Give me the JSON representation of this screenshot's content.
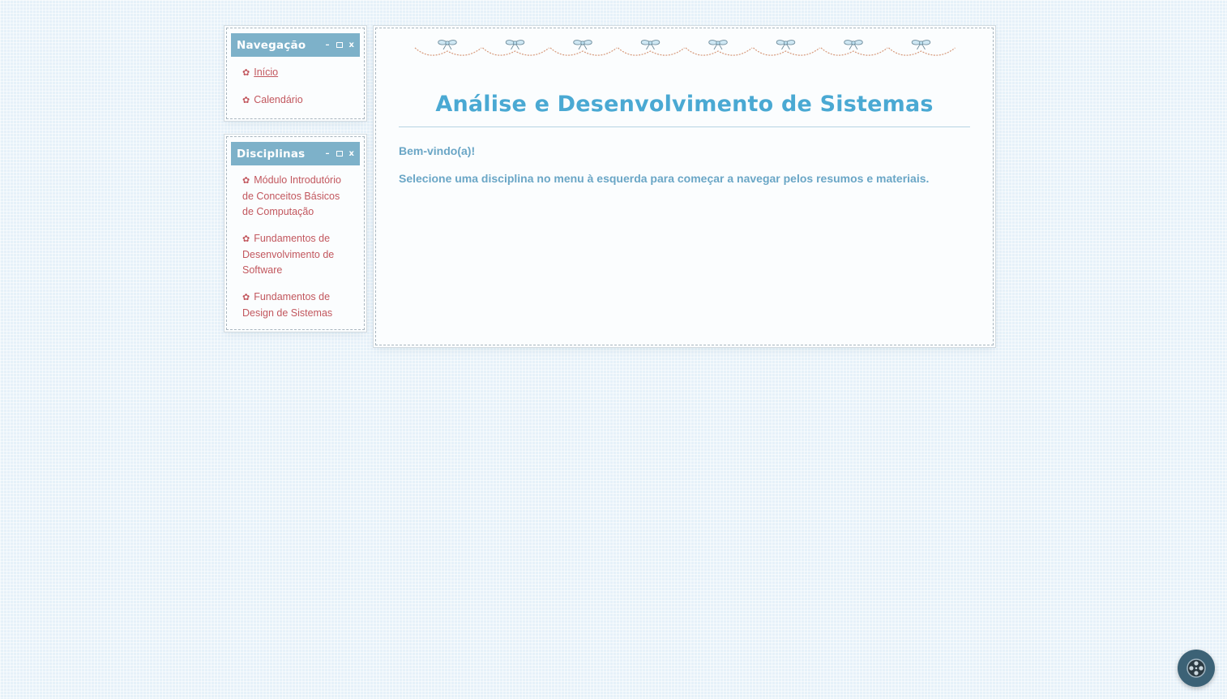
{
  "sidebar": {
    "navigation": {
      "title": "Navegação",
      "controls": {
        "minimize": "–",
        "maximize_icon": "maximize-icon",
        "close": "x"
      },
      "items": [
        {
          "label": "Início",
          "icon": "flower-icon",
          "active": true
        },
        {
          "label": "Calendário",
          "icon": "flower-icon",
          "active": false
        }
      ]
    },
    "disciplines": {
      "title": "Disciplinas",
      "controls": {
        "minimize": "–",
        "maximize_icon": "maximize-icon",
        "close": "x"
      },
      "items": [
        {
          "label": "Módulo Introdutório de Conceitos Básicos de Computação",
          "icon": "flower-icon"
        },
        {
          "label": "Fundamentos de Desenvolvimento de Software",
          "icon": "flower-icon"
        },
        {
          "label": "Fundamentos de Design de Sistemas",
          "icon": "flower-icon"
        }
      ]
    }
  },
  "main": {
    "title": "Análise e Desenvolvimento de Sistemas",
    "welcome": "Bem-vindo(a)!",
    "intro": "Selecione uma disciplina no menu à esquerda para começar a navegar pelos resumos e materiais."
  },
  "icons": {
    "flower": "✿",
    "fab": "film-reel-icon"
  },
  "colors": {
    "accent": "#4aa9d3",
    "link": "#c2575e",
    "titlebar": "#7db1c9",
    "text": "#6aa6c6",
    "background": "#e6f1f9",
    "fab": "#3c6276"
  }
}
